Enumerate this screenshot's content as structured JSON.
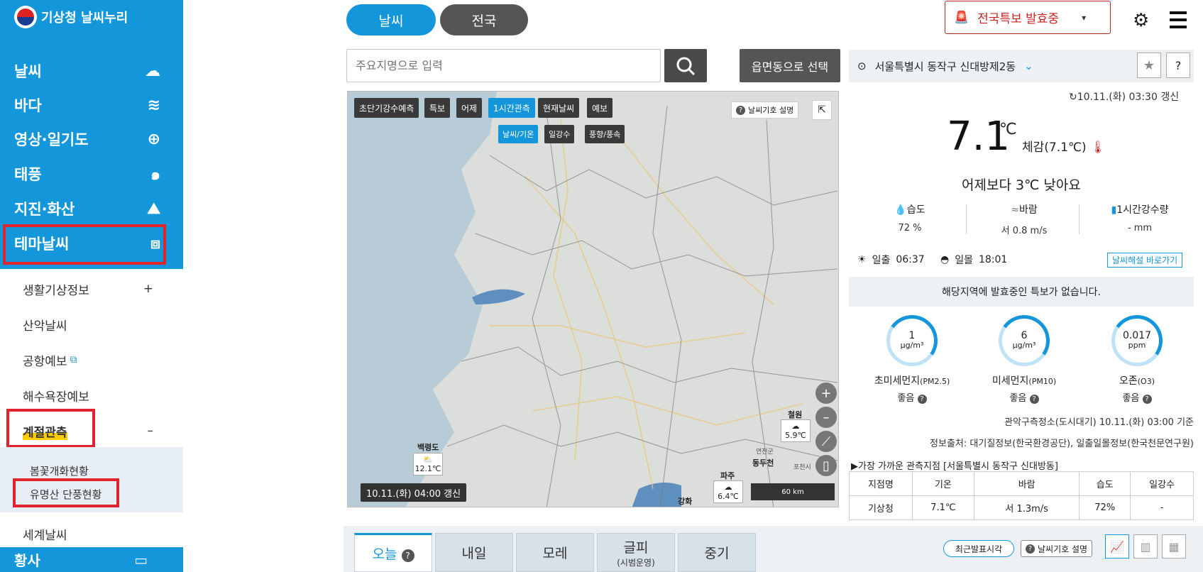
{
  "brand": {
    "name": "기상청 날씨누리"
  },
  "sidebar": {
    "main_items": [
      {
        "label": "날씨",
        "icon": "cloud-sun-icon"
      },
      {
        "label": "바다",
        "icon": "wave-icon"
      },
      {
        "label": "영상·일기도",
        "icon": "satellite-target-icon"
      },
      {
        "label": "태풍",
        "icon": "typhoon-icon"
      },
      {
        "label": "지진·화산",
        "icon": "volcano-icon"
      },
      {
        "label": "테마날씨",
        "icon": "suitcase-icon"
      }
    ],
    "sub_items": [
      {
        "label": "생활기상정보",
        "toggle": "+"
      },
      {
        "label": "산악날씨",
        "toggle": ""
      },
      {
        "label": "공항예보",
        "toggle": ""
      },
      {
        "label": "해수욕장예보",
        "toggle": ""
      },
      {
        "label": "계절관측",
        "toggle": "–"
      }
    ],
    "season_items": [
      "봄꽃개화현황",
      "유명산 단풍현황"
    ],
    "world_weather": "세계날씨",
    "bottom_item": "황사"
  },
  "top": {
    "weather_pill": "날씨",
    "national_pill": "전국",
    "alert_button": "전국특보 발효중",
    "alert_caret": "▾"
  },
  "search": {
    "placeholder": "주요지명으로 입력",
    "region_button": "읍면동으로 선택"
  },
  "map": {
    "tabs": [
      "초단기강수예측",
      "특보",
      "어제",
      "1시간관측",
      "현재날씨",
      "예보"
    ],
    "subtabs": [
      "날씨/기온",
      "일강수",
      "풍향/풍속"
    ],
    "legend_button": "날씨기호 설명",
    "zoom_in": "+",
    "zoom_out": "–",
    "scale": "60 km",
    "update": "10.11.(화) 04:00 갱신",
    "stations": [
      {
        "name": "백령도",
        "temp": "12.1℃"
      },
      {
        "name": "철원",
        "temp": "5.9℃"
      },
      {
        "name": "파주",
        "temp": "6.4℃"
      },
      {
        "name": "동두천",
        "temp": "5.4℃"
      },
      {
        "name": "강화",
        "temp": ""
      }
    ],
    "place_labels": [
      "연천군",
      "포천시"
    ]
  },
  "current": {
    "location": "서울특별시 동작구 신대방제2동",
    "updated": "10.11.(화) 03:30 갱신",
    "temp": "7.1",
    "temp_unit": "℃",
    "feels_like": "체감(7.1℃)",
    "compare": "어제보다 3℃ 낮아요",
    "stats": [
      {
        "label": "습도",
        "value": "72 %",
        "icon": "droplet-icon"
      },
      {
        "label": "바람",
        "value": "서 0.8 m/s",
        "icon": "wind-icon"
      },
      {
        "label": "1시간강수량",
        "value": "- mm",
        "icon": "rain-gauge-icon"
      }
    ],
    "sunrise_label": "일출",
    "sunrise": "06:37",
    "sunset_label": "일몰",
    "sunset": "18:01",
    "explain_link": "날씨해설 바로가기",
    "no_alert": "해당지역에 발효중인 특보가 없습니다."
  },
  "air": [
    {
      "value": "1",
      "unit": "μg/m³",
      "name": "초미세먼지",
      "code": "(PM2.5)",
      "grade": "좋음"
    },
    {
      "value": "6",
      "unit": "μg/m³",
      "name": "미세먼지",
      "code": "(PM10)",
      "grade": "좋음"
    },
    {
      "value": "0.017",
      "unit": "ppm",
      "name": "오존",
      "code": "(O3)",
      "grade": "좋음"
    }
  ],
  "notes": {
    "air_station": "관악구측정소(도시대기) 10.11.(화) 03:00 기준",
    "source": "정보출처: 대기질정보(한국환경공단), 일출일몰정보(한국천문연구원)"
  },
  "nearest": {
    "title": "▶가장 가까운 관측지점 [서울특별시 동작구 신대방동]",
    "headers": [
      "지점명",
      "기온",
      "바람",
      "습도",
      "일강수"
    ],
    "row": [
      "기상청",
      "7.1℃",
      "서 1.3m/s",
      "72%",
      "-"
    ]
  },
  "day_tabs": [
    {
      "label": "오늘",
      "sub": ""
    },
    {
      "label": "내일",
      "sub": ""
    },
    {
      "label": "모레",
      "sub": ""
    },
    {
      "label": "글피",
      "sub": "(시범운영)"
    },
    {
      "label": "중기",
      "sub": ""
    }
  ],
  "bottom": {
    "recent": "최근발표시각",
    "legend": "날씨기호 설명"
  }
}
